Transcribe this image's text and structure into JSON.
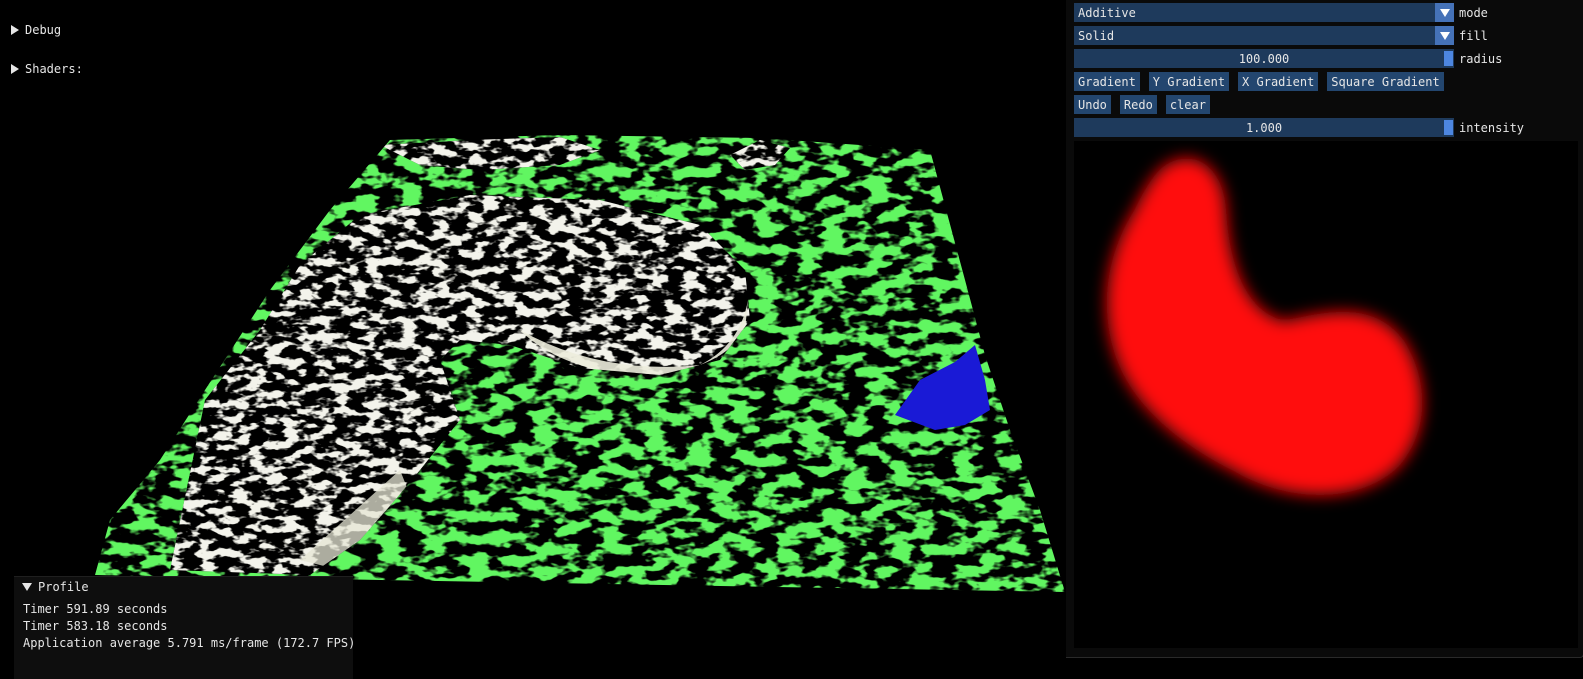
{
  "debug_tree": {
    "label": "Debug"
  },
  "shaders_tree": {
    "label": "Shaders:"
  },
  "profile": {
    "title": "Profile",
    "lines": [
      "Timer 591.89 seconds",
      "Timer 583.18 seconds",
      "Application average 5.791 ms/frame (172.7 FPS)"
    ]
  },
  "brush_panel": {
    "mode": {
      "value": "Additive",
      "label": "mode"
    },
    "fill": {
      "value": "Solid",
      "label": "fill"
    },
    "radius": {
      "value": "100.000",
      "label": "radius",
      "level": 1.0
    },
    "gradient_buttons": [
      "Gradient",
      "Y Gradient",
      "X Gradient",
      "Square Gradient"
    ],
    "edit_buttons": [
      "Undo",
      "Redo",
      "clear"
    ],
    "intensity": {
      "value": "1.000",
      "label": "intensity",
      "level": 1.0
    }
  },
  "colors": {
    "background": "#000000",
    "terrain_grass": "#1ee61e",
    "terrain_rock": "#e6e6d4",
    "terrain_water": "#1a1ad6",
    "brush_stroke": "#ff1010",
    "widget_bg": "#1e3a5c",
    "widget_accent": "#4d86e0",
    "button_bg": "#23466f"
  }
}
